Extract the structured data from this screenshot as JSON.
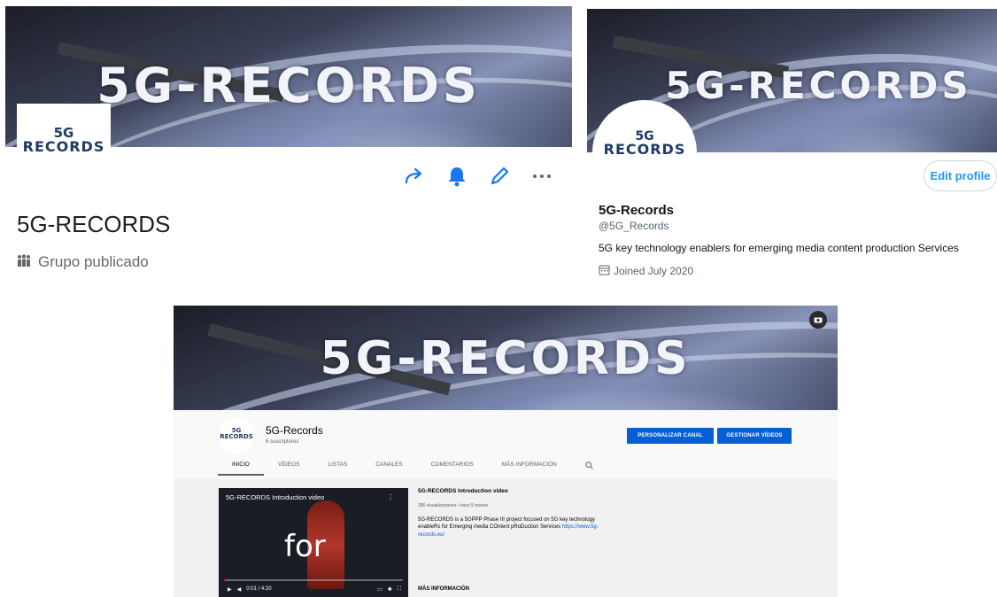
{
  "facebook": {
    "banner_text": "5G-RECORDS",
    "logo_line1": "5G",
    "logo_line2": "RECORDS",
    "name": "5G-RECORDS",
    "status": "Grupo publicado",
    "actions": [
      "share-icon",
      "bell-icon",
      "edit-icon",
      "more-icon"
    ]
  },
  "twitter": {
    "banner_text": "5G-RECORDS",
    "logo_line1": "5G",
    "logo_line2": "RECORDS",
    "edit_button": "Edit profile",
    "name": "5G-Records",
    "handle": "@5G_Records",
    "bio": "5G key technology enablers for emerging media content production Services",
    "joined": "Joined July 2020"
  },
  "youtube": {
    "banner_text": "5G-RECORDS",
    "logo_line1": "5G",
    "logo_line2": "RECORDS",
    "channel_name": "5G-Records",
    "subscribers": "6 suscriptores",
    "btn_customize": "PERSONALIZAR CANAL",
    "btn_manage": "GESTIONAR VÍDEOS",
    "tabs": [
      "INICIO",
      "VÍDEOS",
      "LISTAS",
      "CANALES",
      "COMENTARIOS",
      "MÁS INFORMACIÓN"
    ],
    "video": {
      "title": "5G-RECORDS Introduction video",
      "overlay": "for",
      "time": "0:01 / 4:20",
      "progress": 0.004
    },
    "info": {
      "title": "5G-RECORDS Introduction video",
      "meta": "286 visualizaciones • hace 5 meses",
      "description": "5G-RECORDS is a 5GPPP Phase III project focused on 5G key technology enableRs for Emerging media COntent pRoDuction Services",
      "link": "https://www.5g-records.eu/",
      "more": "MÁS INFORMACIÓN"
    }
  }
}
